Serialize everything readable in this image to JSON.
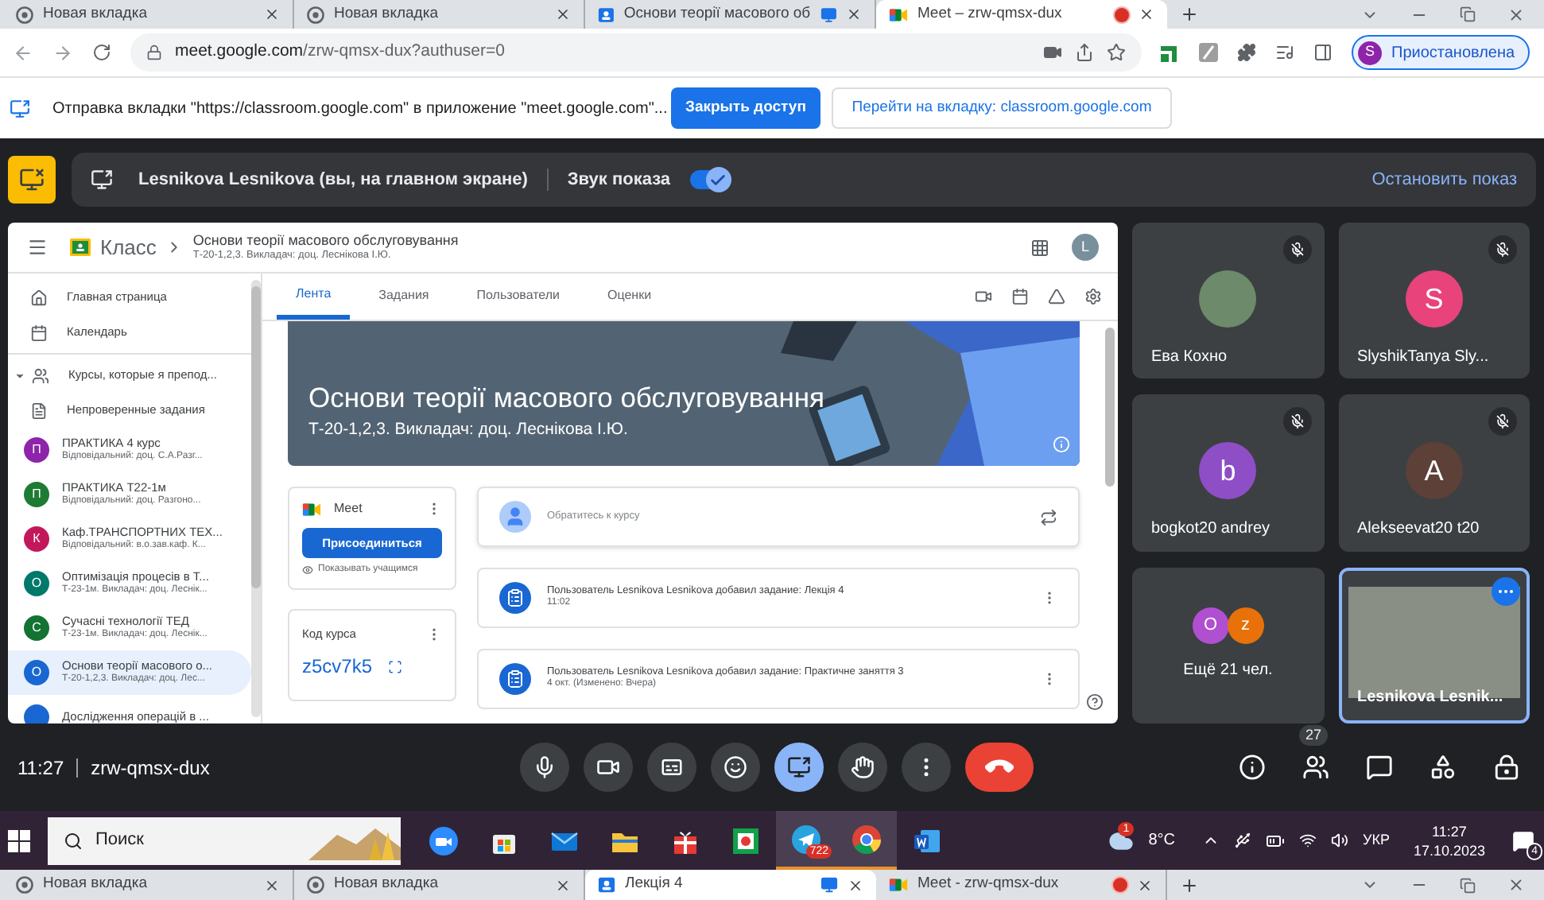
{
  "browser_tabs": [
    {
      "title": "Новая вкладка",
      "kind": "newtab",
      "selected": false,
      "sharing": false,
      "recording": false
    },
    {
      "title": "Новая вкладка",
      "kind": "newtab",
      "selected": false,
      "sharing": false,
      "recording": false
    },
    {
      "title": "Основи теорії масового об",
      "kind": "classroom",
      "selected": false,
      "sharing": true,
      "recording": false
    },
    {
      "title": "Meet – zrw-qmsx-dux",
      "kind": "meet",
      "selected": true,
      "sharing": false,
      "recording": true
    }
  ],
  "address_bar": {
    "host": "meet.google.com",
    "path": "/zrw-qmsx-dux?authuser=0"
  },
  "profile": {
    "initial": "S",
    "label": "Приостановлена"
  },
  "infobar": {
    "message": "Отправка вкладки \"https://classroom.google.com\" в приложение \"meet.google.com\"...",
    "primary_button": "Закрыть доступ",
    "secondary_button": "Перейти на вкладку: classroom.google.com"
  },
  "share_bar": {
    "presenter": "Lesnikova Lesnikova (вы, на главном экране)",
    "audio_label": "Звук показа",
    "audio_on": true,
    "stop": "Остановить показ"
  },
  "classroom": {
    "brand": "Класс",
    "course_title": "Основи теорії масового обслуговування",
    "course_subtitle": "Т-20-1,2,3. Викладач: доц. Леснікова І.Ю.",
    "avatar": "L",
    "sidebar": [
      {
        "kind": "home",
        "label": "Главная страница"
      },
      {
        "kind": "calendar",
        "label": "Календарь"
      },
      {
        "kind": "teaching",
        "label": "Курсы, которые я препод...",
        "expanded": true
      },
      {
        "kind": "review",
        "label": "Непроверенные задания"
      },
      {
        "kind": "course",
        "initial": "П",
        "color": "#8e24aa",
        "label": "ПРАКТИКА 4 курс",
        "subtitle": "Відповідальний: доц. С.А.Разг...",
        "selected": false
      },
      {
        "kind": "course",
        "initial": "П",
        "color": "#1e7b34",
        "label": "ПРАКТИКА Т22-1м",
        "subtitle": "Відповідальний: доц. Разгоно...",
        "selected": false
      },
      {
        "kind": "course",
        "initial": "К",
        "color": "#c2185b",
        "label": "Каф.ТРАНСПОРТНИХ ТЕХ...",
        "subtitle": "Відповідальний: в.о.зав.каф. К...",
        "selected": false
      },
      {
        "kind": "course",
        "initial": "О",
        "color": "#00796b",
        "label": "Оптимізація процесів в Т...",
        "subtitle": "Т-23-1м. Викладач: доц. Леснік...",
        "selected": false
      },
      {
        "kind": "course",
        "initial": "С",
        "color": "#137333",
        "label": "Сучасні технології ТЕД",
        "subtitle": "Т-23-1м. Викладач: доц. Леснік...",
        "selected": false
      },
      {
        "kind": "course",
        "initial": "О",
        "color": "#1967d2",
        "label": "Основи теорії масового о...",
        "subtitle": "Т-20-1,2,3. Викладач: доц. Лес...",
        "selected": true
      },
      {
        "kind": "course",
        "color": "#1967d2",
        "label": "Дослідження операцій в ...",
        "selected": false
      }
    ],
    "tabs": [
      {
        "label": "Лента",
        "selected": true
      },
      {
        "label": "Задания",
        "selected": false
      },
      {
        "label": "Пользователи",
        "selected": false
      },
      {
        "label": "Оценки",
        "selected": false
      }
    ],
    "banner": {
      "title": "Основи теорії масового обслуговування",
      "subtitle": "Т-20-1,2,3. Викладач: доц. Леснікова І.Ю."
    },
    "meet_card": {
      "title": "Meet",
      "button": "Присоединиться",
      "note": "Показывать учащимся"
    },
    "code_card": {
      "title": "Код курса",
      "code": "z5cv7k5"
    },
    "post_box": {
      "placeholder": "Обратитесь к курсу"
    },
    "posts": [
      {
        "text": "Пользователь Lesnikova Lesnikova добавил задание: Лекція 4",
        "time": "11:02"
      },
      {
        "text": "Пользователь Lesnikova Lesnikova добавил задание: Практичне заняття 3",
        "time": "4 окт. (Изменено: Вчера)"
      }
    ]
  },
  "tiles": [
    {
      "kind": "photo",
      "name": "Ева Кохно",
      "muted": true
    },
    {
      "kind": "initial",
      "initial": "S",
      "color": "#e8437a",
      "name": "SlyshikTanya Sly...",
      "muted": true
    },
    {
      "kind": "initial",
      "initial": "b",
      "color": "#8e4ec6",
      "name": "bogkot20 andrey",
      "muted": true
    },
    {
      "kind": "initial",
      "initial": "A",
      "color": "#5d4037",
      "name": "Alekseevat20 t20",
      "muted": true
    },
    {
      "kind": "more",
      "avatars": [
        {
          "initial": "O",
          "color": "#b04fd0"
        },
        {
          "initial": "z",
          "color": "#e8710a"
        }
      ],
      "name": "Ещё 21 чел.",
      "muted": false
    },
    {
      "kind": "self",
      "name": "Lesnikova Lesnik...",
      "muted": false
    }
  ],
  "controls": {
    "time": "11:27",
    "code": "zrw-qmsx-dux",
    "buttons": [
      {
        "kind": "mic",
        "active": false
      },
      {
        "kind": "camera",
        "active": false
      },
      {
        "kind": "captions",
        "active": false
      },
      {
        "kind": "emoji",
        "active": false
      },
      {
        "kind": "present",
        "active": true
      },
      {
        "kind": "hand",
        "active": false
      },
      {
        "kind": "more",
        "active": false
      },
      {
        "kind": "hangup",
        "active": false
      }
    ],
    "side": [
      {
        "kind": "info"
      },
      {
        "kind": "people",
        "badge": "27"
      },
      {
        "kind": "chat"
      },
      {
        "kind": "activities"
      },
      {
        "kind": "host"
      }
    ]
  },
  "taskbar": {
    "search": "Поиск",
    "apps": [
      {
        "kind": "zoom",
        "active": false
      },
      {
        "kind": "store",
        "active": false
      },
      {
        "kind": "mail",
        "active": false
      },
      {
        "kind": "files",
        "active": false
      },
      {
        "kind": "gift",
        "active": false
      },
      {
        "kind": "green",
        "active": false
      },
      {
        "kind": "telegram",
        "active": true,
        "badge": "722"
      },
      {
        "kind": "chrome",
        "active": true
      },
      {
        "kind": "word",
        "active": false
      }
    ],
    "weather_badge": "1",
    "temperature": "8°C",
    "language": "УКР",
    "time": "11:27",
    "date": "17.10.2023",
    "notifications": "4"
  },
  "bottom_tabs": [
    {
      "title": "Новая вкладка",
      "kind": "newtab",
      "selected": false,
      "sharing": false,
      "recording": false
    },
    {
      "title": "Новая вкладка",
      "kind": "newtab",
      "selected": false,
      "sharing": false,
      "recording": false
    },
    {
      "title": "Лекція 4",
      "kind": "classroom",
      "selected": true,
      "sharing": true,
      "recording": false
    },
    {
      "title": "Meet - zrw-qmsx-dux",
      "kind": "meet",
      "selected": false,
      "sharing": false,
      "recording": true
    }
  ]
}
